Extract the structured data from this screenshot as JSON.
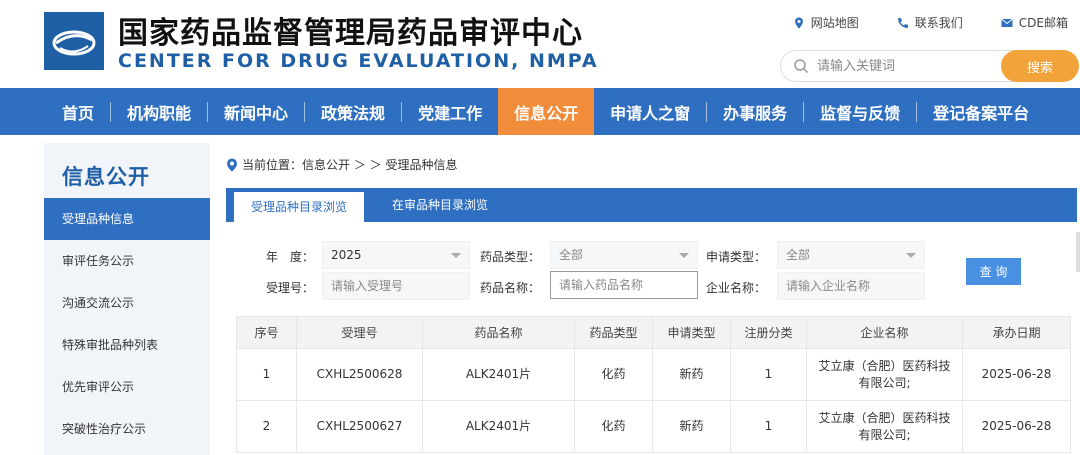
{
  "header": {
    "title_cn": "国家药品监督管理局药品审评中心",
    "title_en": "CENTER FOR DRUG EVALUATION, NMPA",
    "top_links": [
      {
        "label": "网站地图",
        "icon": "location-pin-icon"
      },
      {
        "label": "联系我们",
        "icon": "phone-icon"
      },
      {
        "label": "CDE邮箱",
        "icon": "mail-icon"
      }
    ],
    "search": {
      "placeholder": "请输入关键词",
      "button": "搜索"
    },
    "colors": {
      "brand_blue": "#2f6fc1",
      "accent_orange": "#f08c3a",
      "search_orange": "#f2a33a"
    }
  },
  "nav": {
    "items": [
      "首页",
      "机构职能",
      "新闻中心",
      "政策法规",
      "党建工作",
      "信息公开",
      "申请人之窗",
      "办事服务",
      "监督与反馈",
      "登记备案平台"
    ],
    "active": "信息公开"
  },
  "sidebar": {
    "title": "信息公开",
    "items": [
      "受理品种信息",
      "审评任务公示",
      "沟通交流公示",
      "特殊审批品种列表",
      "优先审评公示",
      "突破性治疗公示"
    ],
    "active": "受理品种信息"
  },
  "breadcrumb": {
    "text": "当前位置：信息公开 ＞ ＞ 受理品种信息"
  },
  "tabs": {
    "active": "受理品种目录浏览",
    "inactive": "在审品种目录浏览"
  },
  "filters": {
    "year_label": "年　度：",
    "year_value": "2025",
    "drug_type_label": "药品类型：",
    "drug_type_value": "全部",
    "apply_type_label": "申请类型：",
    "apply_type_value": "全部",
    "accept_no_label": "受理号：",
    "accept_no_placeholder": "请输入受理号",
    "drug_name_label": "药品名称：",
    "drug_name_placeholder": "请输入药品名称",
    "company_label": "企业名称：",
    "company_placeholder": "请输入企业名称",
    "query_button": "查 询"
  },
  "table": {
    "headers": [
      "序号",
      "受理号",
      "药品名称",
      "药品类型",
      "申请类型",
      "注册分类",
      "企业名称",
      "承办日期"
    ],
    "rows": [
      [
        "1",
        "CXHL2500628",
        "ALK2401片",
        "化药",
        "新药",
        "1",
        "艾立康（合肥）医药科技有限公司;",
        "2025-06-28"
      ],
      [
        "2",
        "CXHL2500627",
        "ALK2401片",
        "化药",
        "新药",
        "1",
        "艾立康（合肥）医药科技有限公司;",
        "2025-06-28"
      ]
    ]
  }
}
